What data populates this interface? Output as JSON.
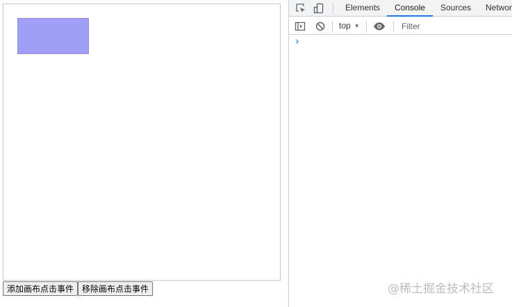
{
  "page": {
    "canvas_rect_fill": "#9f9ff5",
    "buttons": {
      "add_label": "添加画布点击事件",
      "remove_label": "移除画布点击事件"
    }
  },
  "devtools": {
    "tabs": [
      {
        "label": "Elements",
        "active": false
      },
      {
        "label": "Console",
        "active": true
      },
      {
        "label": "Sources",
        "active": false
      },
      {
        "label": "Network",
        "active": false
      }
    ],
    "toolbar": {
      "context": "top",
      "filter_placeholder": "Filter",
      "filter_value": ""
    },
    "console_prompt": "›",
    "icons": [
      "inspect-element-icon",
      "device-toolbar-icon",
      "sidebar-toggle-icon",
      "clear-console-icon",
      "eye-icon"
    ],
    "accent": "#1a73e8"
  },
  "watermark": "@稀土掘金技术社区"
}
